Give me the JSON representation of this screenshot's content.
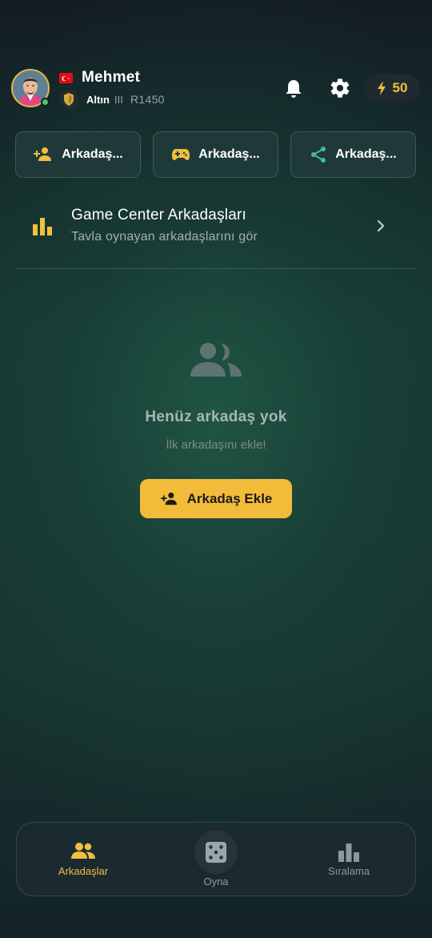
{
  "header": {
    "username": "Mehmet",
    "flag_icon": "turkey-flag-icon",
    "rank_name": "Altın",
    "rank_level": "III",
    "rating": "R1450",
    "energy": "50",
    "accent_color": "#f0bf3c"
  },
  "actions": [
    {
      "label": "Arkadaş...",
      "icon": "add-person-icon"
    },
    {
      "label": "Arkadaş...",
      "icon": "gamepad-icon"
    },
    {
      "label": "Arkadaş...",
      "icon": "share-icon"
    }
  ],
  "game_center": {
    "title": "Game Center Arkadaşları",
    "subtitle": "Tavla oynayan arkadaşlarını gör"
  },
  "empty_state": {
    "title": "Henüz arkadaş yok",
    "subtitle": "İlk arkadaşını ekle!",
    "button_label": "Arkadaş Ekle"
  },
  "nav": {
    "friends": "Arkadaşlar",
    "play": "Oyna",
    "ranking": "Sıralama",
    "active_color": "#f0bf3c"
  }
}
